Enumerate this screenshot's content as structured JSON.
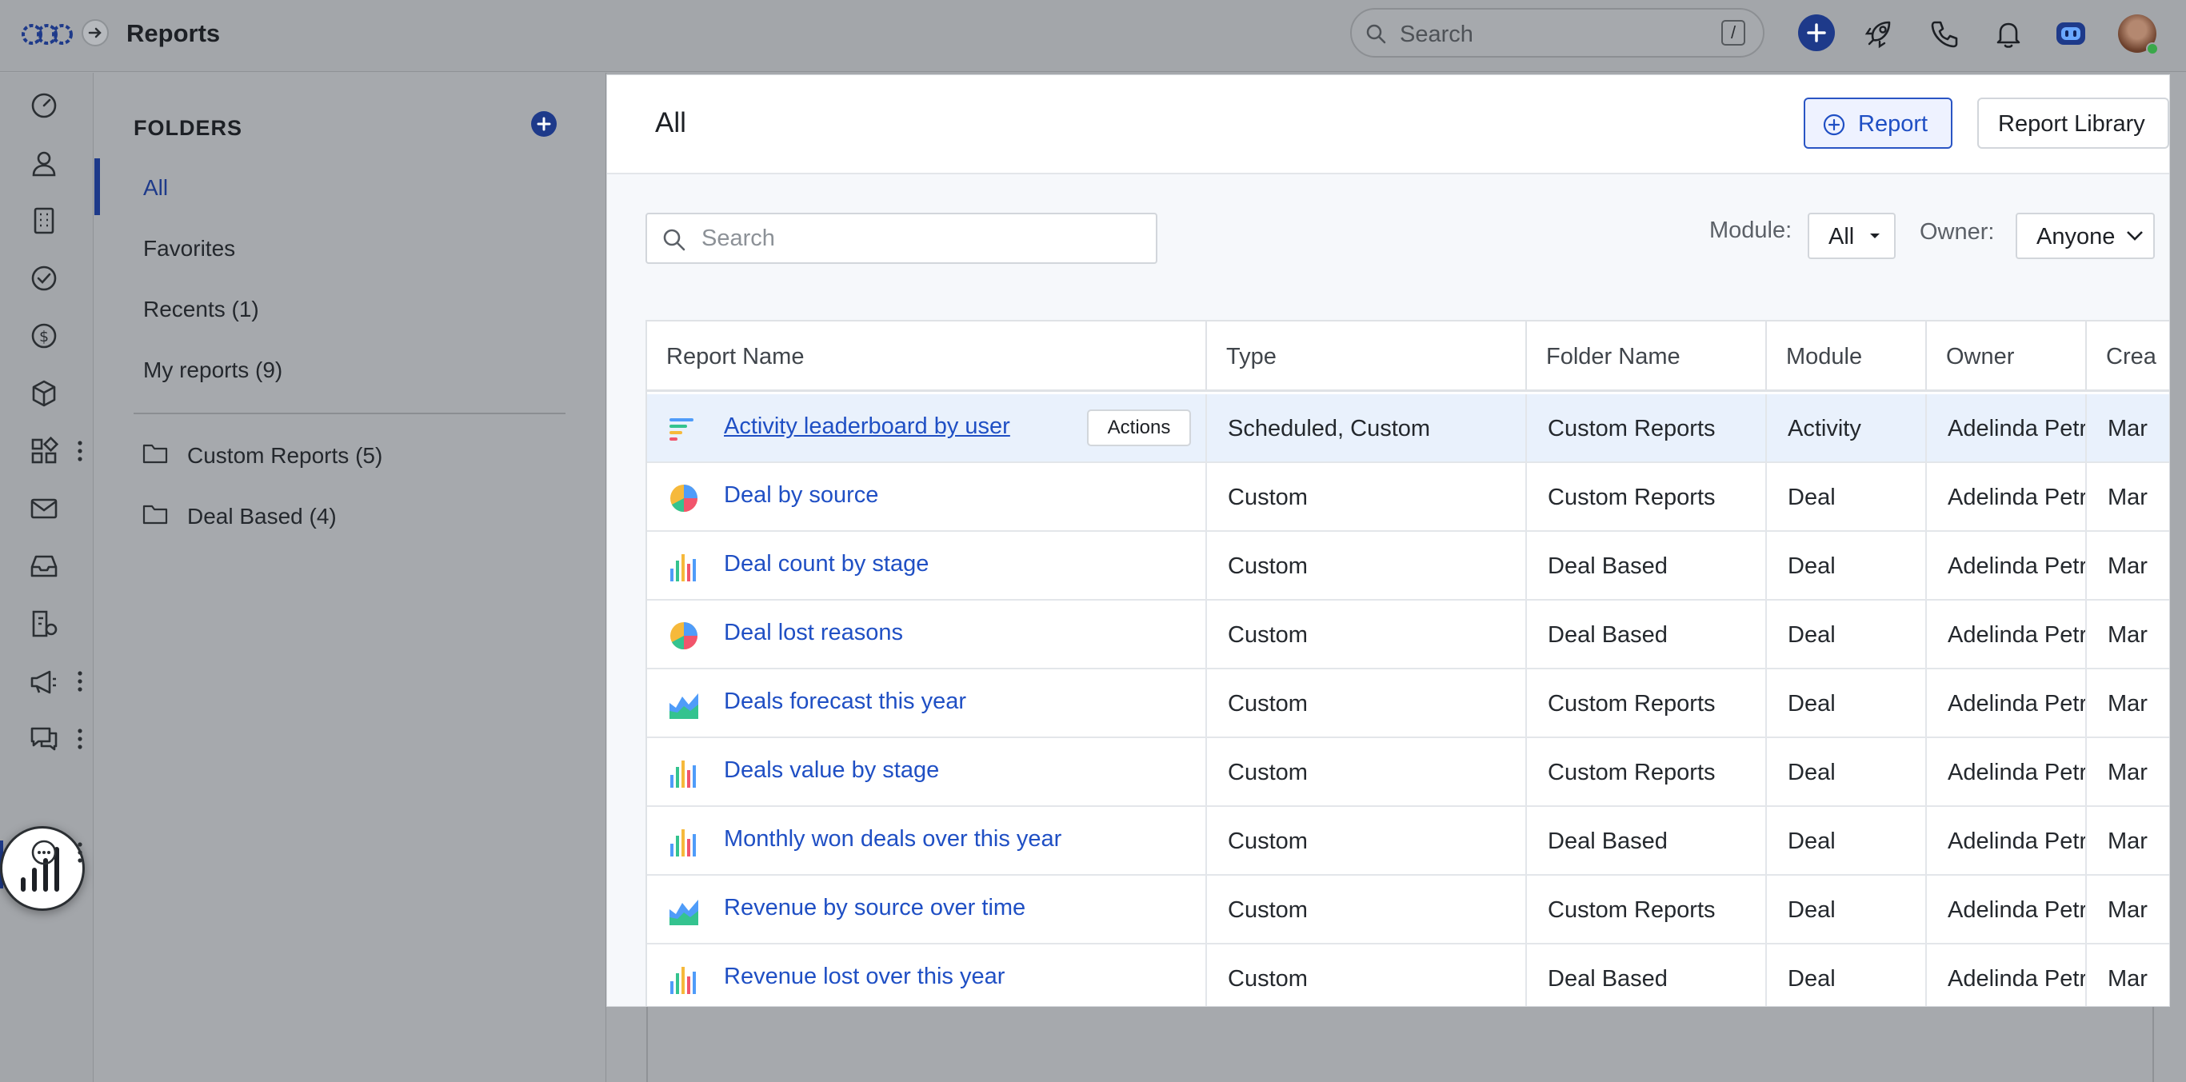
{
  "header": {
    "title": "Reports",
    "search_placeholder": "Search",
    "search_shortcut": "/"
  },
  "folders": {
    "title": "FOLDERS",
    "links": [
      {
        "label": "All"
      },
      {
        "label": "Favorites"
      },
      {
        "label": "Recents (1)"
      },
      {
        "label": "My reports (9)"
      }
    ],
    "custom": [
      {
        "label": "Custom Reports (5)"
      },
      {
        "label": "Deal Based (4)"
      }
    ]
  },
  "main": {
    "title": "All",
    "report_button": "Report",
    "library_button": "Report Library",
    "search_placeholder": "Search",
    "module_label": "Module:",
    "module_value": "All",
    "owner_label": "Owner:",
    "owner_value": "Anyone"
  },
  "table": {
    "columns": [
      "Report Name",
      "Type",
      "Folder Name",
      "Module",
      "Owner",
      "Crea"
    ],
    "actions_label": "Actions",
    "rows": [
      {
        "name": "Activity leaderboard by user",
        "icon": "leaderboard-icon",
        "type": "Scheduled, Custom",
        "folder": "Custom Reports",
        "module": "Activity",
        "owner": "Adelinda Petr",
        "created": "Mar"
      },
      {
        "name": "Deal by source",
        "icon": "pie-chart-icon",
        "type": "Custom",
        "folder": "Custom Reports",
        "module": "Deal",
        "owner": "Adelinda Petr",
        "created": "Mar"
      },
      {
        "name": "Deal count by stage",
        "icon": "bar-chart-icon",
        "type": "Custom",
        "folder": "Deal Based",
        "module": "Deal",
        "owner": "Adelinda Petr",
        "created": "Mar"
      },
      {
        "name": "Deal lost reasons",
        "icon": "pie-chart-icon",
        "type": "Custom",
        "folder": "Deal Based",
        "module": "Deal",
        "owner": "Adelinda Petr",
        "created": "Mar"
      },
      {
        "name": "Deals forecast this year",
        "icon": "area-chart-icon",
        "type": "Custom",
        "folder": "Custom Reports",
        "module": "Deal",
        "owner": "Adelinda Petr",
        "created": "Mar"
      },
      {
        "name": "Deals value by stage",
        "icon": "bar-chart-icon",
        "type": "Custom",
        "folder": "Custom Reports",
        "module": "Deal",
        "owner": "Adelinda Petr",
        "created": "Mar"
      },
      {
        "name": "Monthly won deals over this year",
        "icon": "bar-chart-icon",
        "type": "Custom",
        "folder": "Deal Based",
        "module": "Deal",
        "owner": "Adelinda Petr",
        "created": "Mar"
      },
      {
        "name": "Revenue by source over time",
        "icon": "area-chart-icon",
        "type": "Custom",
        "folder": "Custom Reports",
        "module": "Deal",
        "owner": "Adelinda Petr",
        "created": "Mar"
      },
      {
        "name": "Revenue lost over this year",
        "icon": "bar-chart-icon",
        "type": "Custom",
        "folder": "Deal Based",
        "module": "Deal",
        "owner": "Adelinda Petr",
        "created": "Mar"
      }
    ]
  },
  "colors": {
    "accent": "#1f4fc4",
    "brand_dark": "#1e3a8a",
    "highlight_row": "#e9f1fc"
  }
}
